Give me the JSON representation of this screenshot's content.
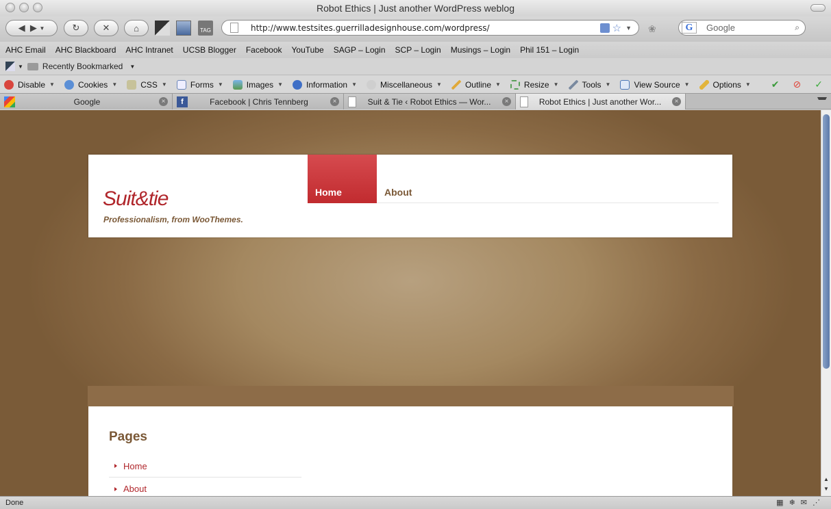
{
  "window": {
    "title": "Robot Ethics | Just another WordPress weblog"
  },
  "nav": {
    "url": "http://www.testsites.guerrilladesignhouse.com/wordpress/",
    "search_value": "Google"
  },
  "bookmarks": [
    "AHC Email",
    "AHC Blackboard",
    "AHC Intranet",
    "UCSB Blogger",
    "Facebook",
    "YouTube",
    "SAGP – Login",
    "SCP – Login",
    "Musings – Login",
    "Phil 151 – Login"
  ],
  "recent": {
    "label": "Recently Bookmarked"
  },
  "devbar": {
    "items": [
      "Disable",
      "Cookies",
      "CSS",
      "Forms",
      "Images",
      "Information",
      "Miscellaneous",
      "Outline",
      "Resize",
      "Tools",
      "View Source",
      "Options"
    ]
  },
  "tabs": [
    {
      "title": "Google"
    },
    {
      "title": "Facebook | Chris Tennberg"
    },
    {
      "title": "Suit & Tie ‹ Robot Ethics — Wor..."
    },
    {
      "title": "Robot Ethics | Just another Wor..."
    }
  ],
  "site": {
    "logo": "Suit&tie",
    "tagline": "Professionalism, from WooThemes.",
    "nav_home": "Home",
    "nav_about": "About",
    "pages_heading": "Pages",
    "pages": [
      "Home",
      "About"
    ]
  },
  "status": {
    "text": "Done"
  },
  "colors": {
    "accent": "#b0262b",
    "brown": "#7a5836",
    "bg": "#a48860"
  }
}
